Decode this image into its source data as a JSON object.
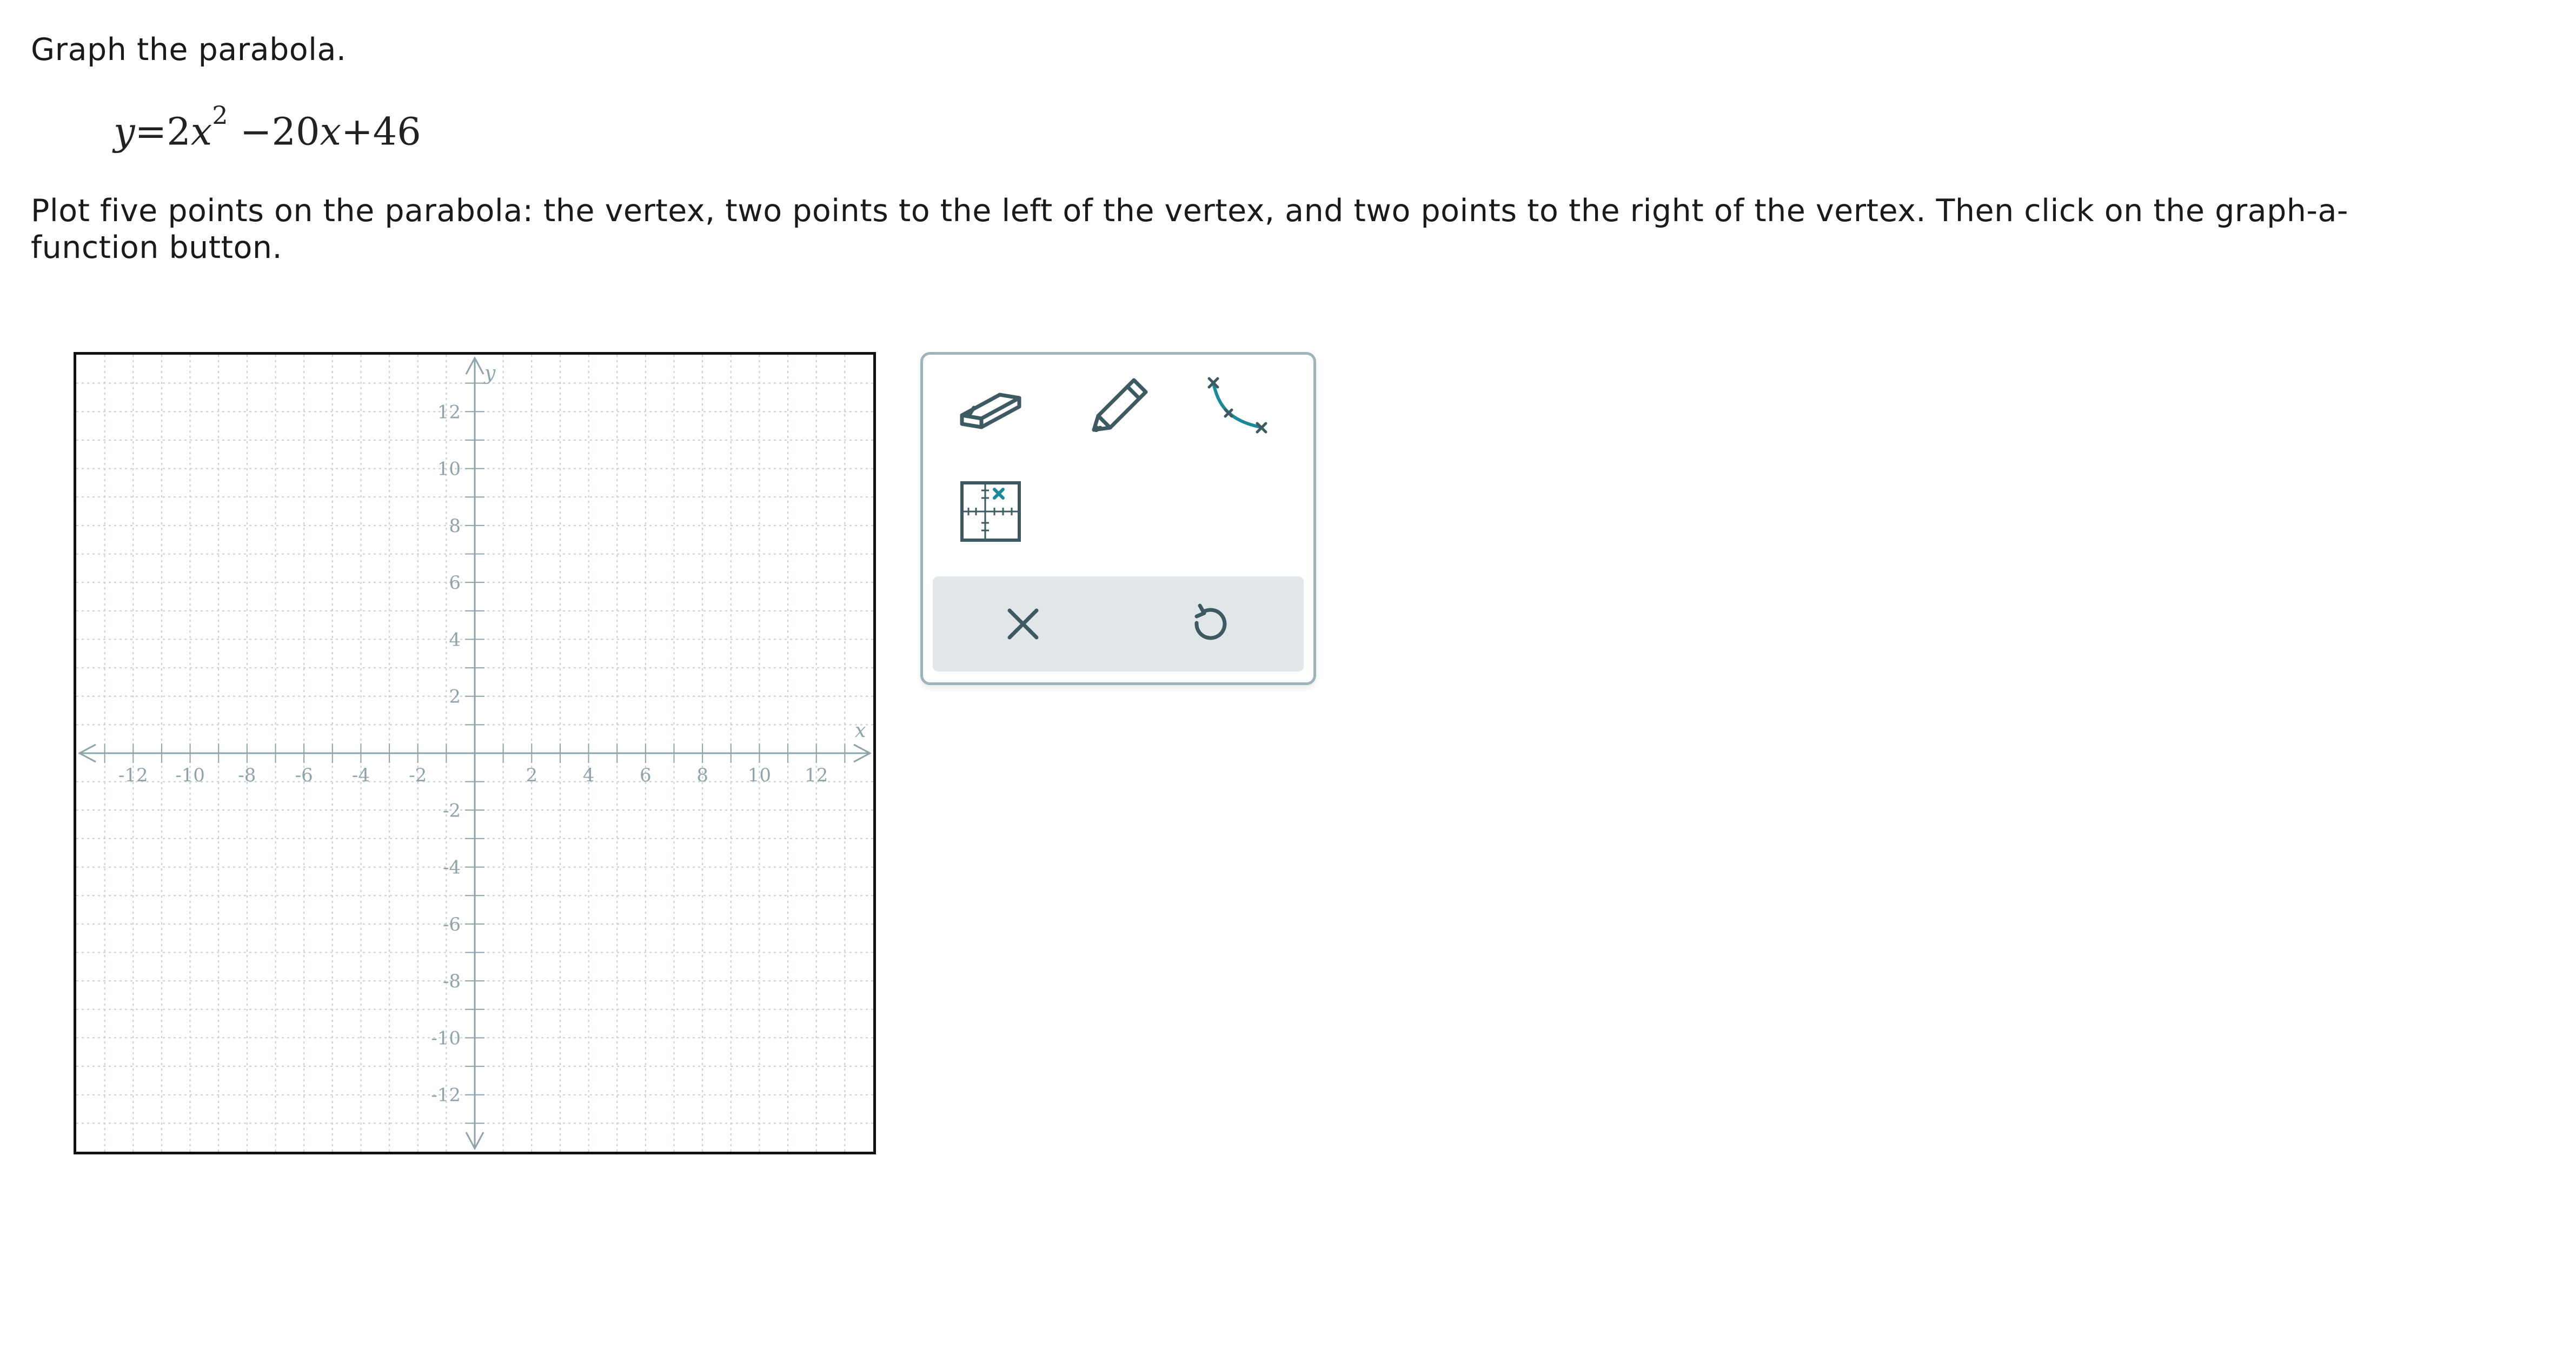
{
  "question": {
    "prompt": "Graph the parabola.",
    "equation": {
      "y": "y",
      "equals": "=",
      "coefficient_a": "2",
      "x1": "x",
      "exponent": "2",
      "minus": "−",
      "coefficient_b": "20",
      "x2": "x",
      "plus": "+",
      "constant": "46"
    },
    "directions": "Plot five points on the parabola: the vertex, two points to the left of the vertex, and two points to the right of the vertex. Then click on the graph-a-function button."
  },
  "graph": {
    "x_axis_label": "x",
    "y_axis_label": "y",
    "x_range": [
      -14,
      14
    ],
    "y_range": [
      -14,
      14
    ],
    "grid_step": 1,
    "x_tick_labels": [
      "-12",
      "-10",
      "-8",
      "-6",
      "-4",
      "-2",
      "2",
      "4",
      "6",
      "8",
      "10",
      "12"
    ],
    "y_tick_labels": [
      "12",
      "10",
      "8",
      "6",
      "4",
      "2",
      "-2",
      "-4",
      "-6",
      "-8",
      "-10",
      "-12"
    ],
    "colors": {
      "axis": "#8fa3aa",
      "grid": "#c4cfd3",
      "label": "#8fa3aa"
    }
  },
  "toolbox": {
    "tools": [
      {
        "name": "eraser",
        "icon": "eraser-icon"
      },
      {
        "name": "pencil",
        "icon": "pencil-icon"
      },
      {
        "name": "graph-a-function",
        "icon": "curve-icon"
      },
      {
        "name": "point",
        "icon": "grid-point-icon"
      }
    ],
    "actions": [
      {
        "name": "clear",
        "icon": "close-icon"
      },
      {
        "name": "undo",
        "icon": "undo-icon"
      }
    ],
    "colors": {
      "icon": "#3d5a63",
      "accent": "#1a8a9a",
      "bar": "#e1e7e8",
      "border": "#9fb3bb"
    }
  }
}
